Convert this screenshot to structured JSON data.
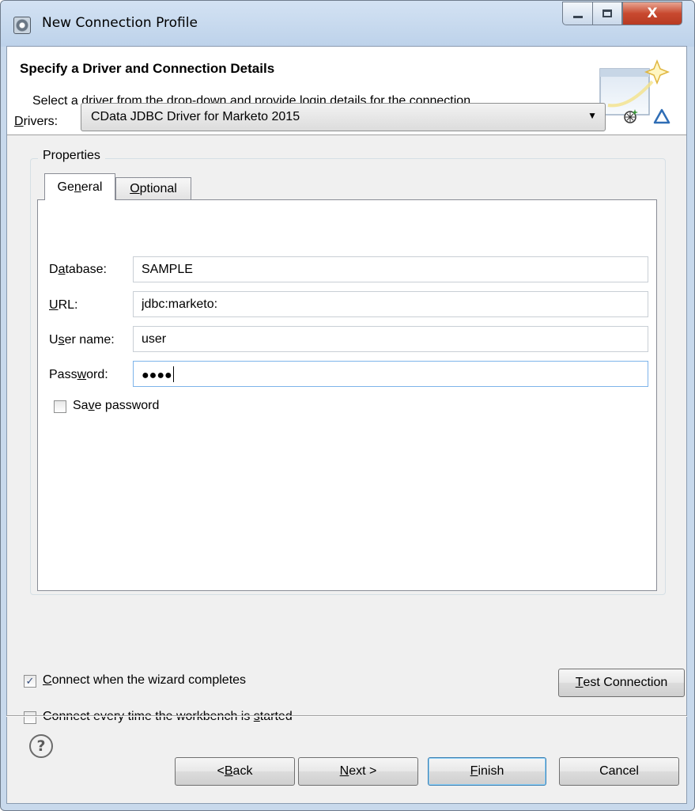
{
  "window": {
    "title": "New Connection Profile",
    "close_glyph": "X"
  },
  "banner": {
    "title": "Specify a Driver and Connection Details",
    "description": "Select a driver from the drop-down and provide login details for the connection."
  },
  "drivers": {
    "label_u": "D",
    "label_rest": "rivers:",
    "selected": "CData JDBC Driver for Marketo 2015",
    "new_driver_icon": "new-driver-icon",
    "edit_driver_icon": "edit-driver-icon"
  },
  "properties": {
    "group_label": "Properties",
    "tabs": [
      {
        "pre": "Ge",
        "u": "n",
        "post": "eral"
      },
      {
        "pre": "",
        "u": "O",
        "post": "ptional"
      }
    ],
    "fields": {
      "database": {
        "pre": "D",
        "u": "a",
        "post": "tabase:",
        "value": "SAMPLE"
      },
      "url": {
        "pre": "",
        "u": "U",
        "post": "RL:",
        "value": "jdbc:marketo:"
      },
      "username": {
        "pre": "U",
        "u": "s",
        "post": "er name:",
        "value": "user"
      },
      "password": {
        "pre": "Pass",
        "u": "w",
        "post": "ord:",
        "value": "●●●●"
      }
    },
    "save_password": {
      "pre": "Sa",
      "u": "v",
      "post": "e password",
      "checked": false
    }
  },
  "options": {
    "connect_on_complete": {
      "pre": "",
      "u": "C",
      "post": "onnect when the wizard completes",
      "checked": true
    },
    "connect_every_time": {
      "pre": "Connect every time the workbench is ",
      "u": "s",
      "post": "tarted",
      "checked": false
    },
    "check_glyph": "✓"
  },
  "buttons": {
    "test_connection": {
      "pre": "",
      "u": "T",
      "post": "est Connection"
    },
    "back": {
      "pre": "< ",
      "u": "B",
      "post": "ack"
    },
    "next": {
      "pre": "",
      "u": "N",
      "post": "ext >"
    },
    "finish": {
      "pre": "",
      "u": "F",
      "post": "inish"
    },
    "cancel": {
      "label": "Cancel"
    },
    "help_glyph": "?"
  },
  "colors": {
    "accent_blue": "#3c7fb1",
    "close_red": "#c8492f",
    "focus_border": "#7eb4ea"
  }
}
